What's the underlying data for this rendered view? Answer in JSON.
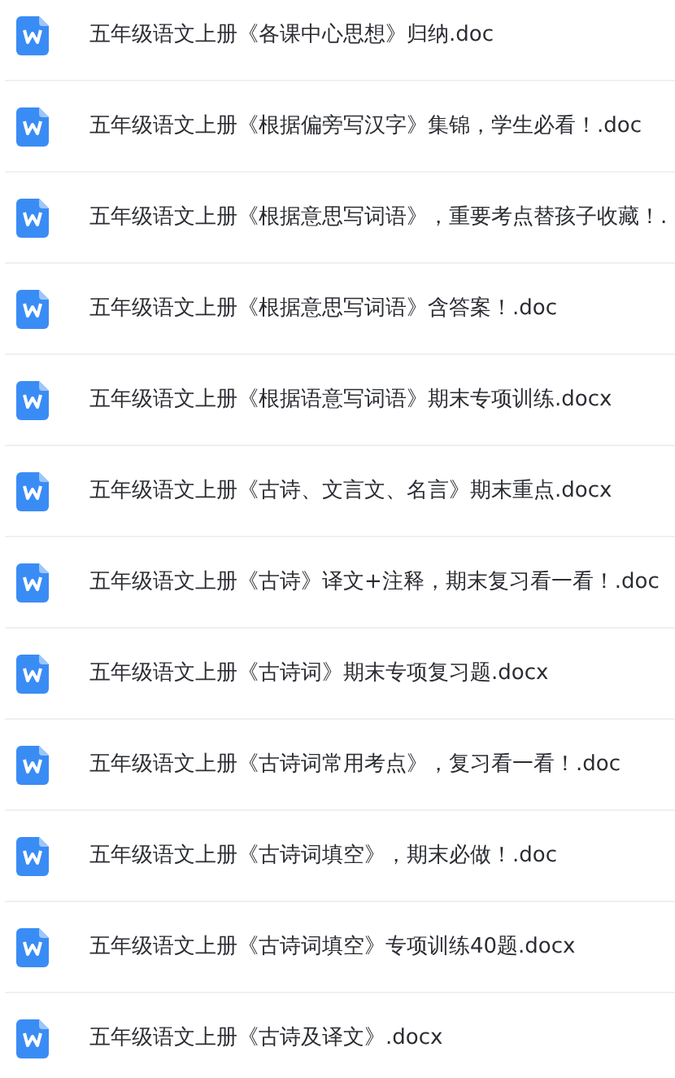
{
  "files": [
    {
      "name": "五年级语文上册《各课中心思想》归纳.doc"
    },
    {
      "name": "五年级语文上册《根据偏旁写汉字》集锦，学生必看！.doc"
    },
    {
      "name": "五年级语文上册《根据意思写词语》，重要考点替孩子收藏！."
    },
    {
      "name": "五年级语文上册《根据意思写词语》含答案！.doc"
    },
    {
      "name": "五年级语文上册《根据语意写词语》期末专项训练.docx"
    },
    {
      "name": "五年级语文上册《古诗、文言文、名言》期末重点.docx"
    },
    {
      "name": "五年级语文上册《古诗》译文+注释，期末复习看一看！.doc"
    },
    {
      "name": "五年级语文上册《古诗词》期末专项复习题.docx"
    },
    {
      "name": "五年级语文上册《古诗词常用考点》，复习看一看！.doc"
    },
    {
      "name": "五年级语文上册《古诗词填空》，期末必做！.doc"
    },
    {
      "name": "五年级语文上册《古诗词填空》专项训练40题.docx"
    },
    {
      "name": "五年级语文上册《古诗及译文》.docx"
    }
  ]
}
